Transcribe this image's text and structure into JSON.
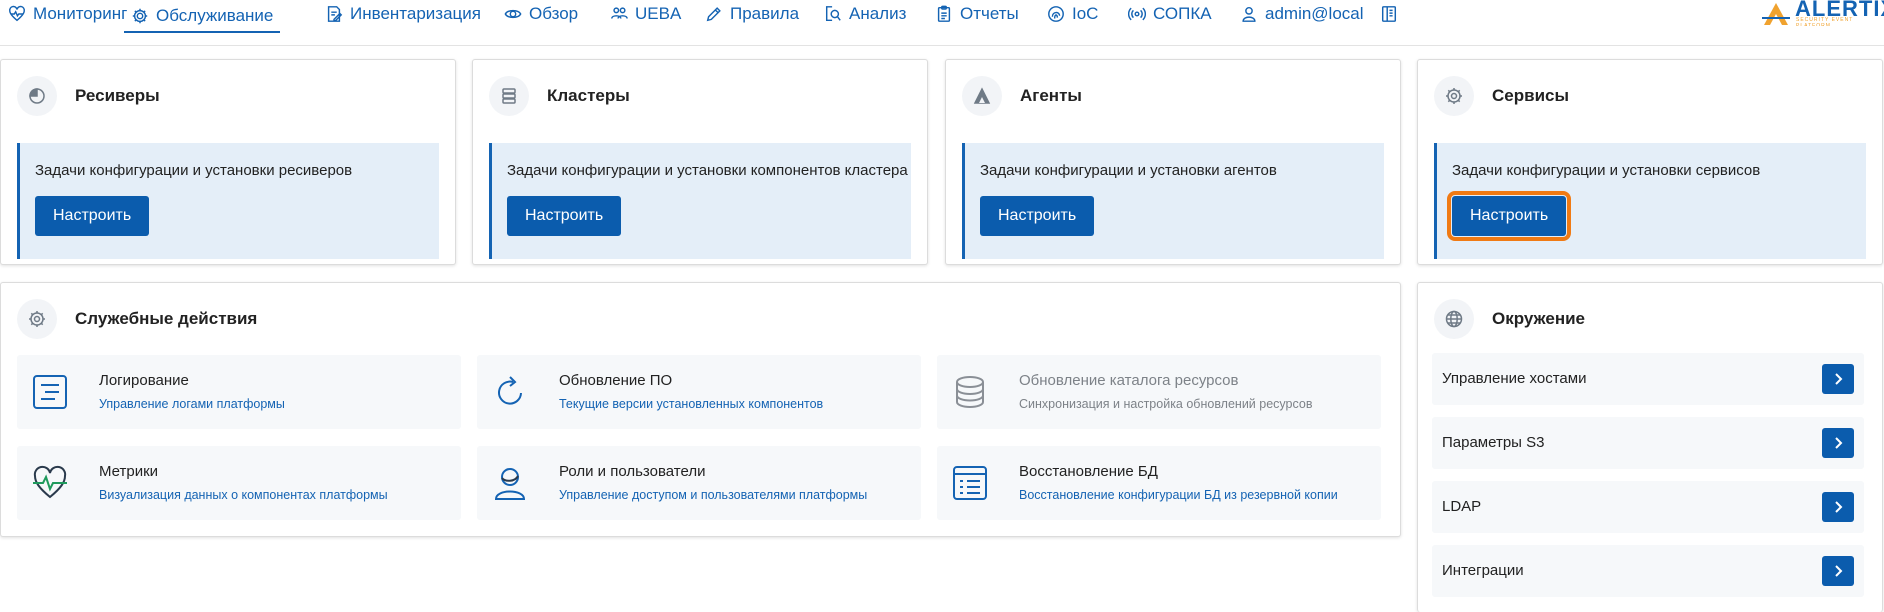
{
  "nav": {
    "monitoring": "Мониторинг",
    "maintenance": "Обслуживание",
    "inventory": "Инвентаризация",
    "overview": "Обзор",
    "ueba": "UEBA",
    "rules": "Правила",
    "analysis": "Анализ",
    "reports": "Отчеты",
    "ioc": "IoC",
    "sopka": "СОПКА",
    "user": "admin@local"
  },
  "logo": {
    "name": "ALERTIX",
    "tagline": "SECURITY EVENT PLATFORM"
  },
  "cards": {
    "receivers": {
      "title": "Ресиверы",
      "description": "Задачи конфигурации и установки ресиверов",
      "button": "Настроить"
    },
    "clusters": {
      "title": "Кластеры",
      "description": "Задачи конфигурации и установки компонентов кластера",
      "button": "Настроить"
    },
    "agents": {
      "title": "Агенты",
      "description": "Задачи конфигурации и установки агентов",
      "button": "Настроить"
    },
    "services": {
      "title": "Сервисы",
      "description": "Задачи конфигурации и установки сервисов",
      "button": "Настроить"
    }
  },
  "service_actions": {
    "title": "Служебные действия",
    "items": [
      {
        "title": "Логирование",
        "subtitle": "Управление логами платформы",
        "icon": "list-doc-icon"
      },
      {
        "title": "Обновление ПО",
        "subtitle": "Текущие версии установленных компонентов",
        "icon": "refresh-icon"
      },
      {
        "title": "Обновление каталога ресурсов",
        "subtitle": "Синхронизация и настройка обновлений ресурсов",
        "icon": "database-icon"
      },
      {
        "title": "Метрики",
        "subtitle": "Визуализация данных о компонентах платформы",
        "icon": "heart-pulse-icon"
      },
      {
        "title": "Роли и пользователи",
        "subtitle": "Управление доступом и пользователями платформы",
        "icon": "user-icon"
      },
      {
        "title": "Восстановление БД",
        "subtitle": "Восстановление конфигурации БД из резервной копии",
        "icon": "list-restore-icon"
      }
    ]
  },
  "environment": {
    "title": "Окружение",
    "items": [
      {
        "label": "Управление хостами"
      },
      {
        "label": "Параметры S3"
      },
      {
        "label": "LDAP"
      },
      {
        "label": "Интеграции"
      }
    ]
  },
  "colors": {
    "accent": "#1463b3",
    "button": "#0b5cad",
    "highlight": "#f07a14",
    "panel": "#e4eef8"
  }
}
